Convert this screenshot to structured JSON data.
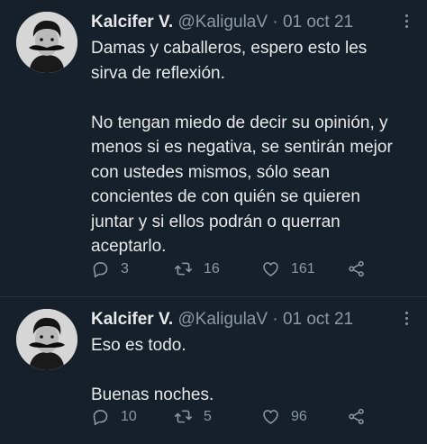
{
  "tweets": [
    {
      "author_name": "Kalcifer V.",
      "handle": "@KaligulaV",
      "separator": "·",
      "date": "01 oct 21",
      "paragraphs": [
        [
          "Damas y caballeros, espero esto les",
          "sirva de reflexión."
        ],
        [
          "No tengan miedo de decir su opinión, y",
          "menos si es negativa, se sentirán mejor",
          "con ustedes mismos, sólo sean",
          "concientes de con quién se quieren",
          "juntar y si ellos podrán o querran",
          "aceptarlo."
        ]
      ],
      "replies": "3",
      "retweets": "16",
      "likes": "161"
    },
    {
      "author_name": "Kalcifer V.",
      "handle": "@KaligulaV",
      "separator": "·",
      "date": "01 oct 21",
      "paragraphs": [
        [
          "Eso es todo."
        ],
        [
          "Buenas noches."
        ]
      ],
      "replies": "10",
      "retweets": "5",
      "likes": "96"
    }
  ],
  "icons": {
    "reply": "reply-icon",
    "retweet": "retweet-icon",
    "like": "heart-icon",
    "share": "share-icon",
    "more": "more-icon"
  },
  "colors": {
    "background": "#15202b",
    "text": "#e7e9ea",
    "muted": "#8b98a5",
    "divider": "#2f3336"
  }
}
